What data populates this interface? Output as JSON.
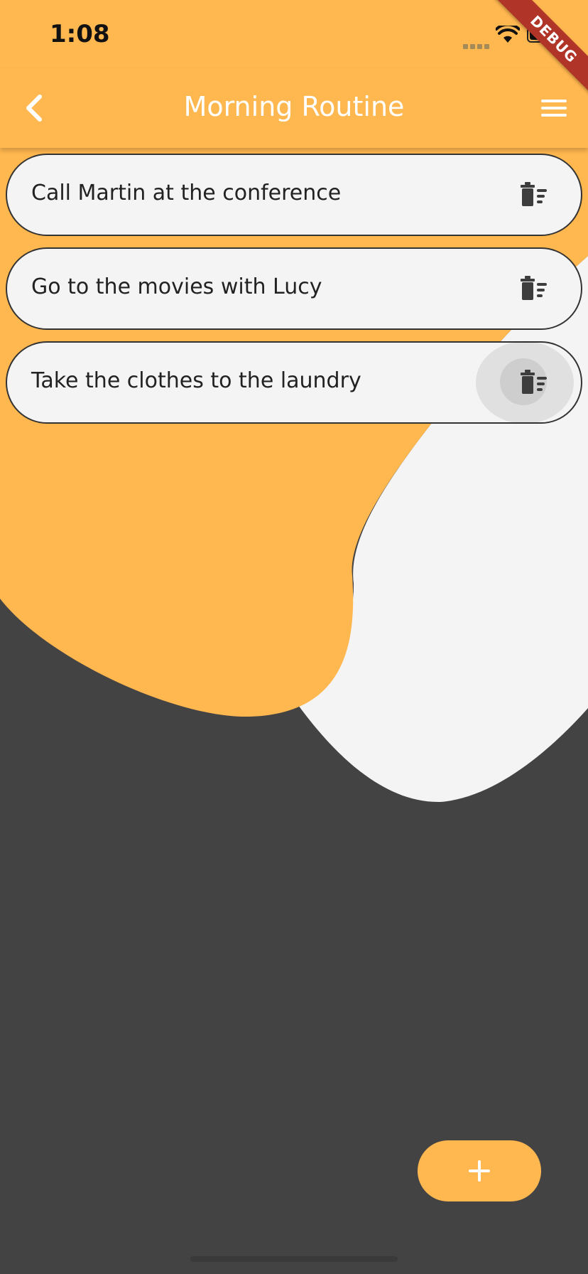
{
  "status_bar": {
    "time": "1:08",
    "icons": [
      "cellular-signal-icon",
      "wifi-icon",
      "battery-icon"
    ],
    "debug_label": "DEBUG"
  },
  "app_bar": {
    "title": "Morning Routine",
    "back_icon": "chevron-left-icon",
    "menu_icon": "hamburger-menu-icon"
  },
  "tasks": [
    {
      "label": "Call Martin at the conference",
      "action_icon": "delete-sweep-icon"
    },
    {
      "label": "Go to the movies with Lucy",
      "action_icon": "delete-sweep-icon"
    },
    {
      "label": "Take the clothes to the laundry",
      "action_icon": "delete-sweep-icon"
    }
  ],
  "fab": {
    "icon": "plus-icon"
  },
  "colors": {
    "accent": "#ffb74f",
    "dark_background": "#434343",
    "light_blob": "#f4f4f4",
    "item_background": "#f4f4f4",
    "debug_banner": "#b03428"
  }
}
